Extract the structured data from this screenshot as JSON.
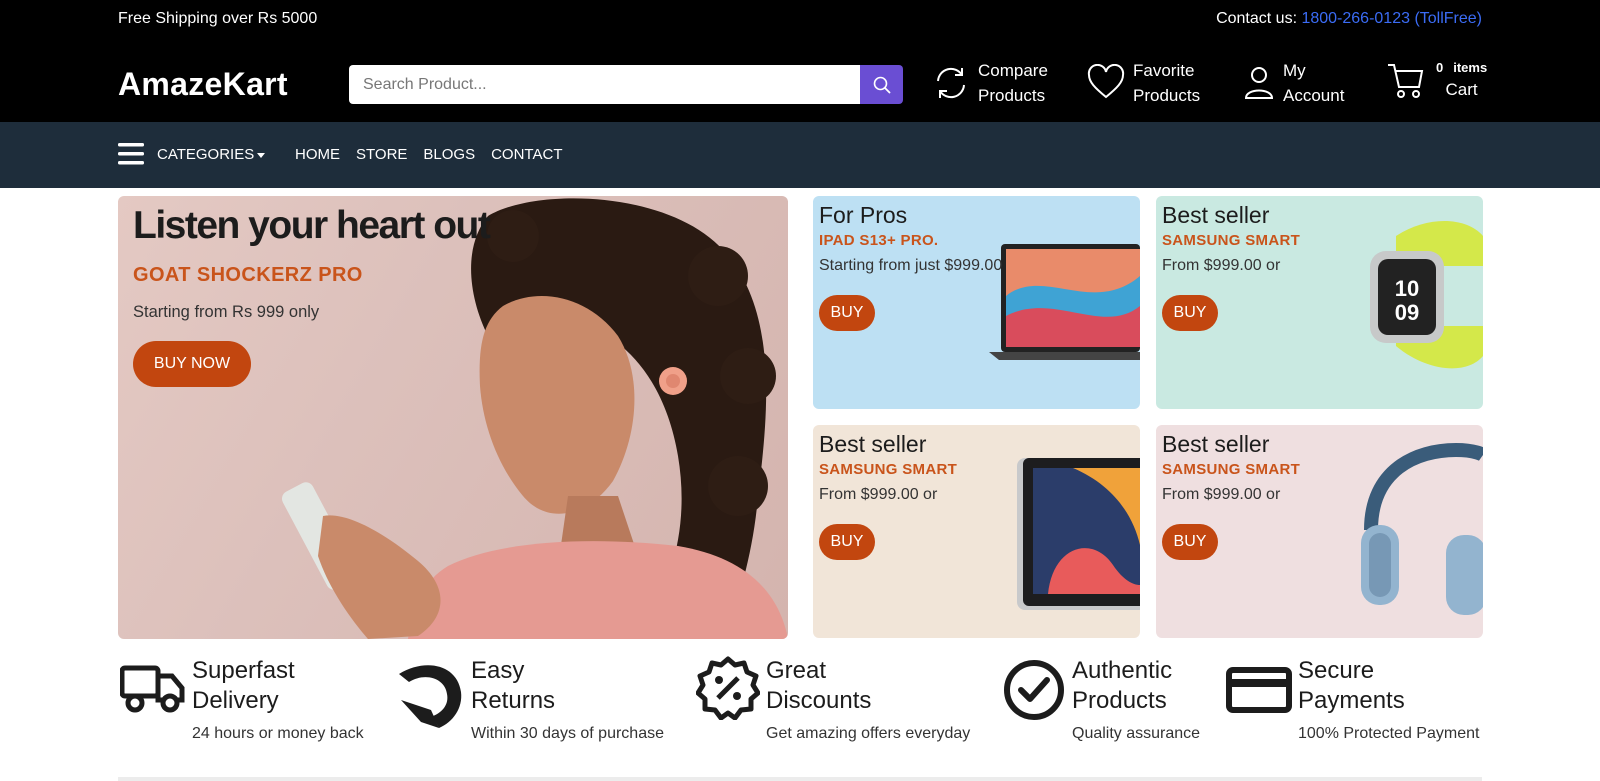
{
  "topbar": {
    "left_text": "Free Shipping over Rs 5000",
    "contact_label": "Contact us: ",
    "contact_phone": "1800-266-0123 (TollFree)"
  },
  "header": {
    "logo": "AmazeKart",
    "search_placeholder": "Search Product...",
    "compare": [
      "Compare",
      "Products"
    ],
    "favorite": [
      "Favorite",
      "Products"
    ],
    "account": [
      "My",
      "Account"
    ],
    "cart": {
      "count": "0",
      "count_label": "items",
      "label": "Cart"
    }
  },
  "nav": {
    "categories": "CATEGORIES",
    "links": [
      "HOME",
      "STORE",
      "BLOGS",
      "CONTACT"
    ]
  },
  "hero": {
    "title": "Listen your heart out",
    "subtitle": "GOAT SHOCKERZ PRO",
    "price": "Starting from Rs 999 only",
    "button": "BUY NOW"
  },
  "cards": [
    {
      "title": "For Pros",
      "subtitle": "IPAD S13+ PRO.",
      "price": "Starting from just $999.00",
      "button": "BUY",
      "bg": "#bde0f3",
      "product": "laptop"
    },
    {
      "title": "Best seller",
      "subtitle": "SAMSUNG SMART",
      "price": "From $999.00 or",
      "button": "BUY",
      "bg": "#c9e9e1",
      "product": "smartwatch"
    },
    {
      "title": "Best seller",
      "subtitle": "SAMSUNG SMART",
      "price": "From $999.00 or",
      "button": "BUY",
      "bg": "#f1e5d8",
      "product": "tablet"
    },
    {
      "title": "Best seller",
      "subtitle": "SAMSUNG SMART",
      "price": "From $999.00 or",
      "button": "BUY",
      "bg": "#efdfe0",
      "product": "headphones"
    }
  ],
  "features": [
    {
      "title": [
        "Superfast",
        "Delivery"
      ],
      "desc": "24 hours or money back",
      "icon": "truck-icon"
    },
    {
      "title": [
        "Easy",
        "Returns"
      ],
      "desc": "Within 30 days of purchase",
      "icon": "return-arrow-icon"
    },
    {
      "title": [
        "Great",
        "Discounts"
      ],
      "desc": "Get amazing offers everyday",
      "icon": "discount-badge-icon"
    },
    {
      "title": [
        "Authentic",
        "Products"
      ],
      "desc": "Quality assurance",
      "icon": "check-circle-icon"
    },
    {
      "title": [
        "Secure",
        "Payments"
      ],
      "desc": "100% Protected Payment",
      "icon": "credit-card-icon"
    }
  ],
  "colors": {
    "accent": "#c2460f",
    "search_button": "#6a4ed3",
    "nav_bg": "#1e2d3b",
    "link": "#3b6cf5"
  }
}
